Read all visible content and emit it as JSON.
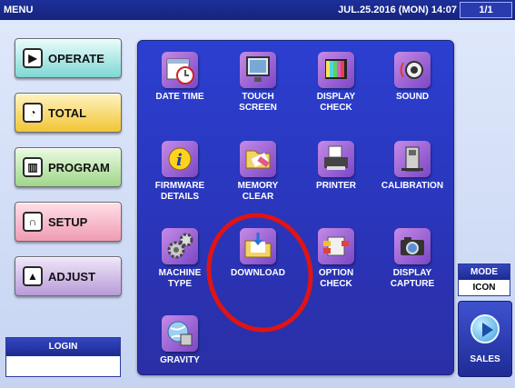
{
  "topbar": {
    "menu": "MENU",
    "datetime": "JUL.25.2016 (MON)  14:07",
    "page": "1/1"
  },
  "left_menu": [
    {
      "label": "OPERATE",
      "icon": "play-icon"
    },
    {
      "label": "TOTAL",
      "icon": "clock-icon"
    },
    {
      "label": "PROGRAM",
      "icon": "book-icon"
    },
    {
      "label": "SETUP",
      "icon": "magnet-icon"
    },
    {
      "label": "ADJUST",
      "icon": "scale-icon"
    }
  ],
  "login": {
    "label": "LOGIN"
  },
  "tiles": [
    {
      "line1": "DATE TIME",
      "line2": "",
      "icon": "calendar-clock-icon"
    },
    {
      "line1": "TOUCH",
      "line2": "SCREEN",
      "icon": "monitor-icon"
    },
    {
      "line1": "DISPLAY",
      "line2": "CHECK",
      "icon": "color-bars-icon"
    },
    {
      "line1": "SOUND",
      "line2": "",
      "icon": "speaker-icon"
    },
    {
      "line1": "FIRMWARE",
      "line2": "DETAILS",
      "icon": "info-icon"
    },
    {
      "line1": "MEMORY",
      "line2": "CLEAR",
      "icon": "folder-eraser-icon"
    },
    {
      "line1": "PRINTER",
      "line2": "",
      "icon": "printer-icon"
    },
    {
      "line1": "CALIBRATION",
      "line2": "",
      "icon": "calibration-icon"
    },
    {
      "line1": "MACHINE",
      "line2": "TYPE",
      "icon": "gears-icon"
    },
    {
      "line1": "DOWNLOAD",
      "line2": "",
      "icon": "download-folder-icon"
    },
    {
      "line1": "OPTION",
      "line2": "CHECK",
      "icon": "option-check-icon"
    },
    {
      "line1": "DISPLAY",
      "line2": "CAPTURE",
      "icon": "camera-icon"
    },
    {
      "line1": "GRAVITY",
      "line2": "",
      "icon": "globe-gravity-icon"
    }
  ],
  "mode": {
    "label": "MODE",
    "value": "ICON"
  },
  "sales": {
    "label": "SALES",
    "icon": "play-circle-icon"
  },
  "colors": {
    "accent": "#2a34b8",
    "highlight_circle": "#e01414"
  }
}
